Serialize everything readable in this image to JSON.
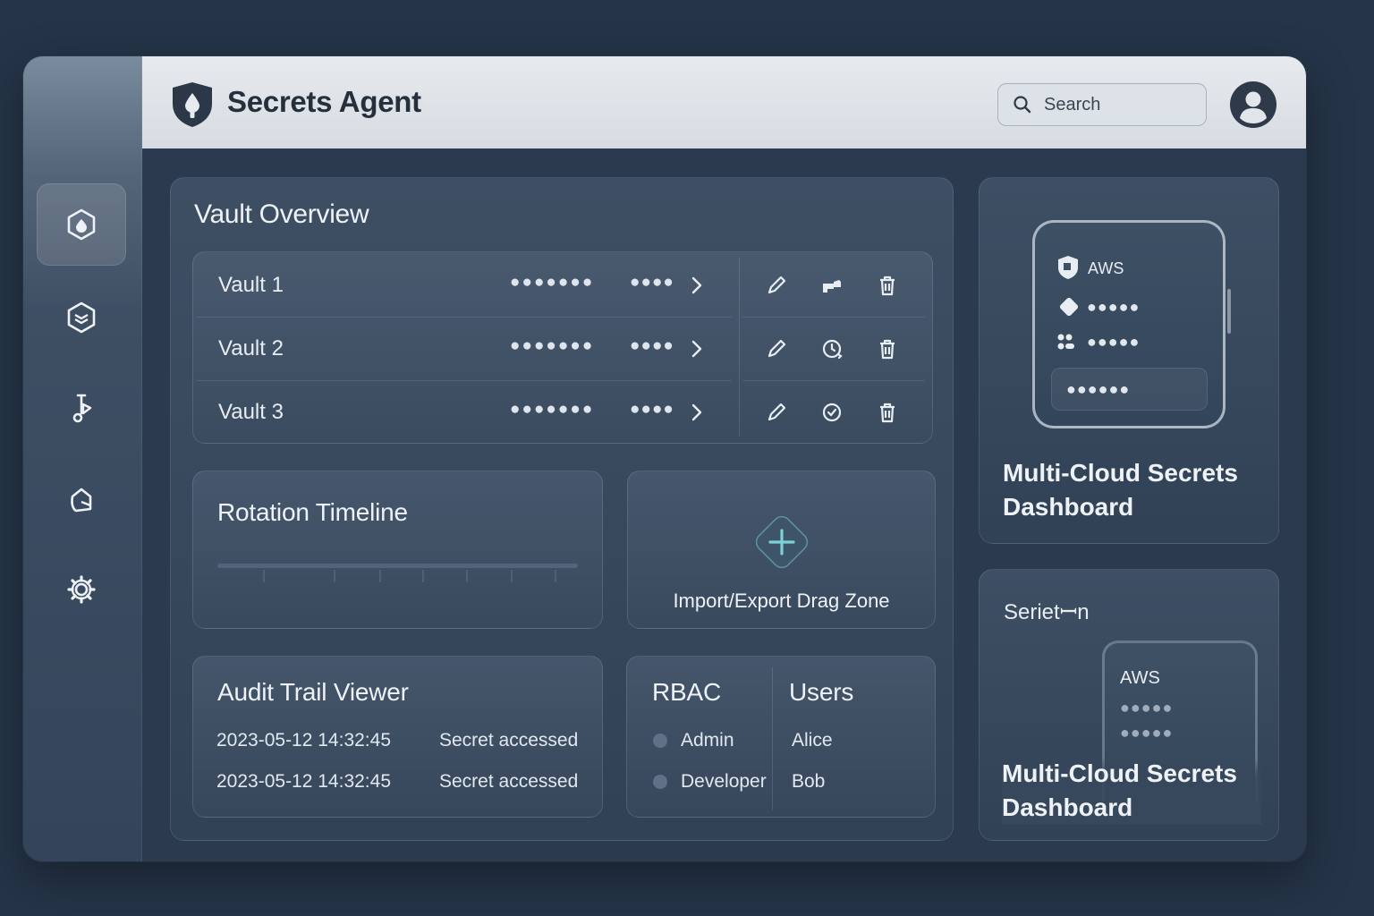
{
  "app": {
    "title": "Secrets Agent"
  },
  "search": {
    "placeholder": "Search"
  },
  "sidebar": {
    "items": [
      {
        "name": "home",
        "icon": "vault-hex-icon"
      },
      {
        "name": "layers",
        "icon": "layers-hex-icon"
      },
      {
        "name": "keys",
        "icon": "key-tag-icon"
      },
      {
        "name": "policies",
        "icon": "shield-doc-icon"
      },
      {
        "name": "settings",
        "icon": "gear-icon"
      }
    ]
  },
  "vault_overview": {
    "title": "Vault Overview",
    "rows": [
      {
        "name": "Vault 1",
        "mask_a": "●●●●●●●",
        "mask_b": "●●●●"
      },
      {
        "name": "Vault 2",
        "mask_a": "●●●●●●●",
        "mask_b": "●●●●"
      },
      {
        "name": "Vault 3",
        "mask_a": "●●●●●●●",
        "mask_b": "●●●●"
      }
    ]
  },
  "rotation": {
    "title": "Rotation Timeline"
  },
  "dropzone": {
    "label": "Import/Export Drag Zone"
  },
  "audit": {
    "title": "Audit Trail Viewer",
    "entries": [
      {
        "time": "2023-05-12 14:32:45",
        "event": "Secret accessed"
      },
      {
        "time": "2023-05-12 14:32:45",
        "event": "Secret accessed"
      }
    ]
  },
  "rbac": {
    "title": "RBAC",
    "users_title": "Users",
    "roles": [
      "Admin",
      "Developer"
    ],
    "users": [
      "Alice",
      "Bob"
    ]
  },
  "multicloud_1": {
    "provider": "AWS",
    "mask_a": "●●●●●",
    "mask_b": "●●●●●",
    "mask_c": "●●●●●●",
    "title": "Multi-Cloud Secrets Dashboard"
  },
  "multicloud_2": {
    "label": "Serietꟷn",
    "provider": "AWS",
    "mask_a": "●●●●●",
    "mask_b": "●●●●●",
    "title": "Multi-Cloud Secrets Dashboard"
  },
  "colors": {
    "accent": "#7fd0d6",
    "background": "#253448",
    "header": "#e2e6eb"
  }
}
